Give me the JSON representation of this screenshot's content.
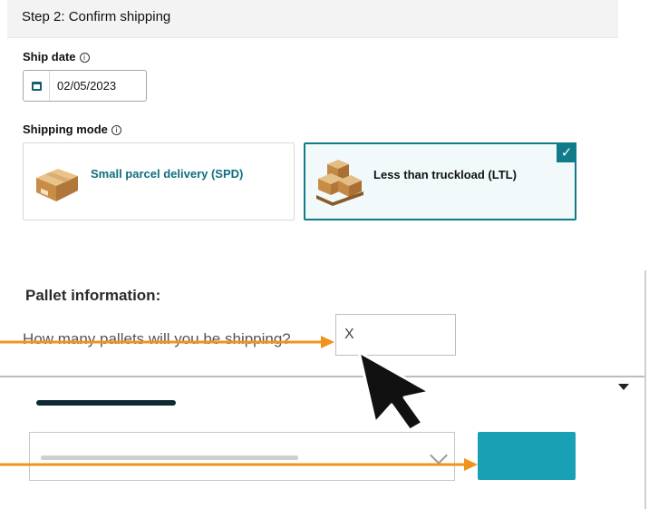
{
  "step": {
    "title": "Step 2: Confirm shipping"
  },
  "ship_date": {
    "label": "Ship date",
    "info_icon": "info-icon",
    "value": "02/05/2023",
    "icon": "calendar-icon"
  },
  "shipping_mode": {
    "label": "Shipping mode",
    "info_icon": "info-icon",
    "options": [
      {
        "label": "Small parcel delivery (SPD)",
        "selected": false,
        "icon": "parcel-box-icon"
      },
      {
        "label": "Less than truckload (LTL)",
        "selected": true,
        "icon": "pallet-boxes-icon"
      }
    ],
    "check_glyph": "✓"
  },
  "pallet": {
    "title": "Pallet information:",
    "question": "How many pallets will you be shipping?",
    "input_value": "X"
  },
  "colors": {
    "accent": "#117b89",
    "button": "#1aa0b4",
    "annotation_arrow": "#f0931d",
    "cursor": "#111111"
  }
}
